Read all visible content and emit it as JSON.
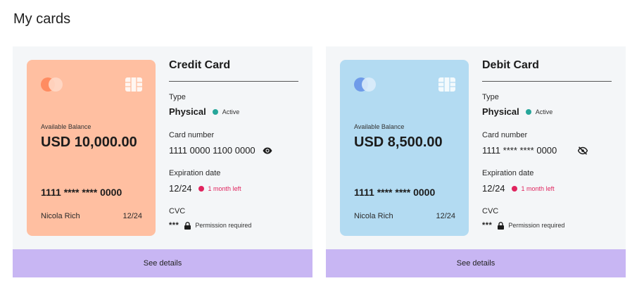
{
  "page_title": "My cards",
  "cards": [
    {
      "card_title": "Credit Card",
      "balance_label": "Available Balance",
      "balance": "USD 10,000.00",
      "masked_number": "1111 **** **** 0000",
      "holder": "Nicola Rich",
      "expiry_short": "12/24",
      "type_label": "Type",
      "type_value": "Physical",
      "status": "Active",
      "number_label": "Card number",
      "number_value": "1111 0000 1100 0000",
      "number_toggle_icon": "eye-icon",
      "expiration_label": "Expiration date",
      "expiration_value": "12/24",
      "expiration_note": "1 month left",
      "cvc_label": "CVC",
      "cvc_value": "***",
      "cvc_note": "Permission required",
      "details_button": "See details",
      "card_color": "#ffbfa1"
    },
    {
      "card_title": "Debit Card",
      "balance_label": "Available Balance",
      "balance": "USD 8,500.00",
      "masked_number": "1111 **** **** 0000",
      "holder": "Nicola Rich",
      "expiry_short": "12/24",
      "type_label": "Type",
      "type_value": "Physical",
      "status": "Active",
      "number_label": "Card number",
      "number_value": "1111 **** **** 0000",
      "number_toggle_icon": "eye-off-icon",
      "expiration_label": "Expiration date",
      "expiration_value": "12/24",
      "expiration_note": "1 month left",
      "cvc_label": "CVC",
      "cvc_value": "***",
      "cvc_note": "Permission required",
      "details_button": "See details",
      "card_color": "#b3dbf2"
    }
  ],
  "colors": {
    "status_active": "#26a69a",
    "expiry_warning": "#e0245e",
    "footer_bg": "#c8b6f3",
    "panel_bg": "#f4f6f8"
  }
}
